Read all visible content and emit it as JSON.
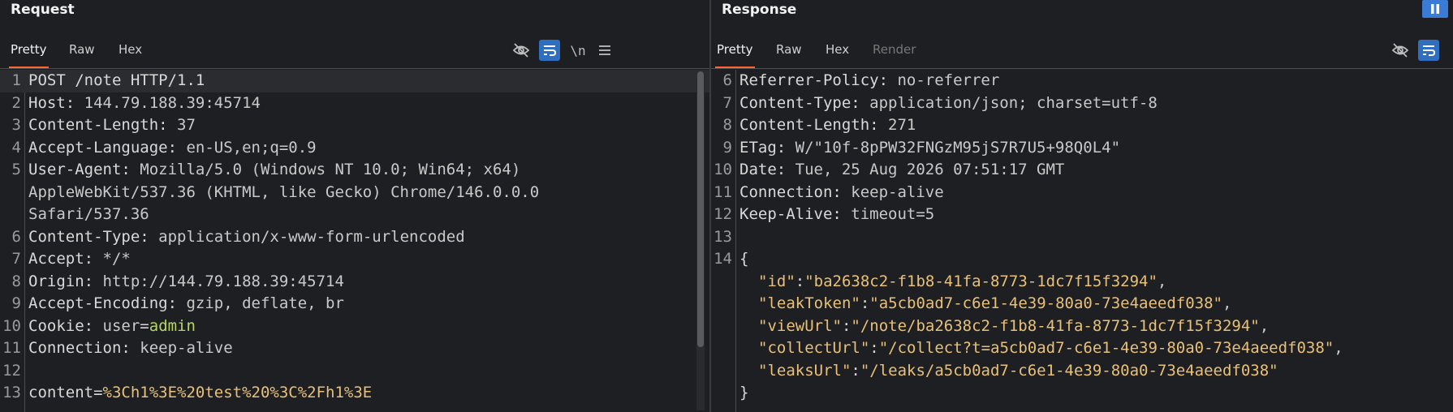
{
  "request": {
    "title": "Request",
    "tabs": [
      "Pretty",
      "Raw",
      "Hex"
    ],
    "active_tab": "Pretty",
    "tools": {
      "newline_label": "\\n"
    },
    "lines": [
      {
        "n": "1",
        "k": "POST /note HTTP/1.1",
        "v": ""
      },
      {
        "n": "2",
        "k": "Host:",
        "v": " 144.79.188.39:45714"
      },
      {
        "n": "3",
        "k": "Content-Length:",
        "v": " 37"
      },
      {
        "n": "4",
        "k": "Accept-Language:",
        "v": " en-US,en;q=0.9"
      },
      {
        "n": "5",
        "k": "User-Agent:",
        "v": " Mozilla/5.0 (Windows NT 10.0; Win64; x64)"
      },
      {
        "n": "",
        "k": "",
        "v": "AppleWebKit/537.36 (KHTML, like Gecko) Chrome/146.0.0.0"
      },
      {
        "n": "",
        "k": "",
        "v": "Safari/537.36"
      },
      {
        "n": "6",
        "k": "Content-Type:",
        "v": " application/x-www-form-urlencoded"
      },
      {
        "n": "7",
        "k": "Accept:",
        "v": " */*"
      },
      {
        "n": "8",
        "k": "Origin:",
        "v": " http://144.79.188.39:45714"
      },
      {
        "n": "9",
        "k": "Accept-Encoding:",
        "v": " gzip, deflate, br"
      },
      {
        "n": "10",
        "k": "Cookie:",
        "v": " user=admin"
      },
      {
        "n": "11",
        "k": "Connection:",
        "v": " keep-alive"
      },
      {
        "n": "12",
        "k": "",
        "v": ""
      },
      {
        "n": "13",
        "k": "content=",
        "v": "%3Ch1%3E%20test%20%3C%2Fh1%3E"
      }
    ],
    "cookie": {
      "name": "user",
      "value": "admin"
    }
  },
  "response": {
    "title": "Response",
    "tabs": [
      "Pretty",
      "Raw",
      "Hex",
      "Render"
    ],
    "active_tab": "Pretty",
    "lines": [
      {
        "n": "6",
        "k": "Referrer-Policy:",
        "v": " no-referrer"
      },
      {
        "n": "7",
        "k": "Content-Type:",
        "v": " application/json; charset=utf-8"
      },
      {
        "n": "8",
        "k": "Content-Length:",
        "v": " 271"
      },
      {
        "n": "9",
        "k": "ETag:",
        "v": " W/\"10f-8pPW32FNGzM95jS7R7U5+98Q0L4\""
      },
      {
        "n": "10",
        "k": "Date:",
        "v": " Tue, 25 Aug 2026 07:51:17 GMT"
      },
      {
        "n": "11",
        "k": "Connection:",
        "v": " keep-alive"
      },
      {
        "n": "12",
        "k": "Keep-Alive:",
        "v": " timeout=5"
      },
      {
        "n": "13",
        "k": "",
        "v": ""
      }
    ],
    "json_start_line": "14",
    "json_open": "{",
    "json_close": "}",
    "json": [
      {
        "k": "\"id\"",
        "v": "\"ba2638c2-f1b8-41fa-8773-1dc7f15f3294\"",
        "sep": ","
      },
      {
        "k": "\"leakToken\"",
        "v": "\"a5cb0ad7-c6e1-4e39-80a0-73e4aeedf038\"",
        "sep": ","
      },
      {
        "k": "\"viewUrl\"",
        "v": "\"/note/ba2638c2-f1b8-41fa-8773-1dc7f15f3294\"",
        "sep": ","
      },
      {
        "k": "\"collectUrl\"",
        "v": "\"/collect?t=a5cb0ad7-c6e1-4e39-80a0-73e4aeedf038\"",
        "sep": ","
      },
      {
        "k": "\"leaksUrl\"",
        "v": "\"/leaks/a5cb0ad7-c6e1-4e39-80a0-73e4aeedf038\"",
        "sep": ""
      }
    ]
  },
  "icons": {
    "hide": "eye-slash-icon",
    "wrap": "word-wrap-icon",
    "menu": "hamburger-menu-icon",
    "pause": "pause-icon"
  },
  "colors": {
    "accent": "#ff6633",
    "selected": "#2f6fbf",
    "value": "#e8c07a",
    "cookie_value": "#b7d56a"
  }
}
